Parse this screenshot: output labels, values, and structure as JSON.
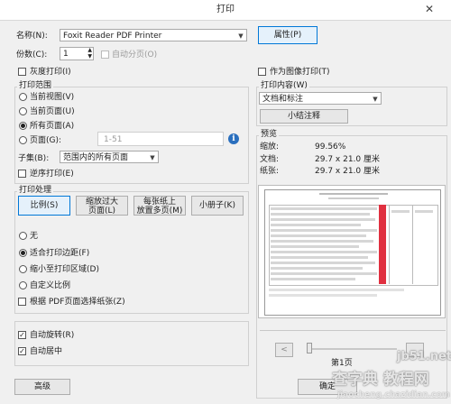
{
  "window": {
    "title": "打印",
    "close_glyph": "✕"
  },
  "printer": {
    "name_label": "名称(N):",
    "name_value": "Foxit Reader PDF Printer",
    "properties_button": "属性(P)",
    "copies_label": "份数(C):",
    "copies_value": "1",
    "collate_label": "自动分页(O)",
    "grayscale_label": "灰度打印(I)",
    "as_image_label": "作为图像打印(T)"
  },
  "print_range": {
    "title": "打印范围",
    "current_view": "当前视图(V)",
    "current_page": "当前页面(U)",
    "all_pages": "所有页面(A)",
    "pages_label": "页面(G):",
    "pages_value": "1-51",
    "info_glyph": "i",
    "subset_label": "子集(B):",
    "subset_value": "范围内的所有页面",
    "reverse_label": "逆序打印(E)"
  },
  "print_content": {
    "title": "打印内容(W)",
    "content_value": "文档和标注",
    "summarize_button": "小结注释"
  },
  "preview": {
    "title": "预览",
    "zoom_label": "缩放:",
    "zoom_value": "99.56%",
    "doc_label": "文档:",
    "doc_value": "29.7 x 21.0 厘米",
    "paper_label": "纸张:",
    "paper_value": "29.7 x 21.0 厘米",
    "prev_button": "<",
    "page_text": "第1页"
  },
  "handling": {
    "title": "打印处理",
    "scale_button": "比例(S)",
    "tile_button_line1": "缩放过大",
    "tile_button_line2": "页面(L)",
    "multiple_button_line1": "每张纸上",
    "multiple_button_line2": "放置多页(M)",
    "booklet_button": "小册子(K)",
    "none": "无",
    "fit_margins": "适合打印边距(F)",
    "shrink": "缩小至打印区域(D)",
    "custom_scale": "自定义比例",
    "choose_paper": "根据 PDF页面选择纸张(Z)"
  },
  "options": {
    "auto_rotate": "自动旋转(R)",
    "auto_center": "自动居中"
  },
  "footer": {
    "advanced_button": "高级",
    "ok_button": "确定"
  },
  "watermark": {
    "line1": "查字典 教程网",
    "line2": "jiaocheng.chazidian.com",
    "line3": "jb51.net"
  }
}
